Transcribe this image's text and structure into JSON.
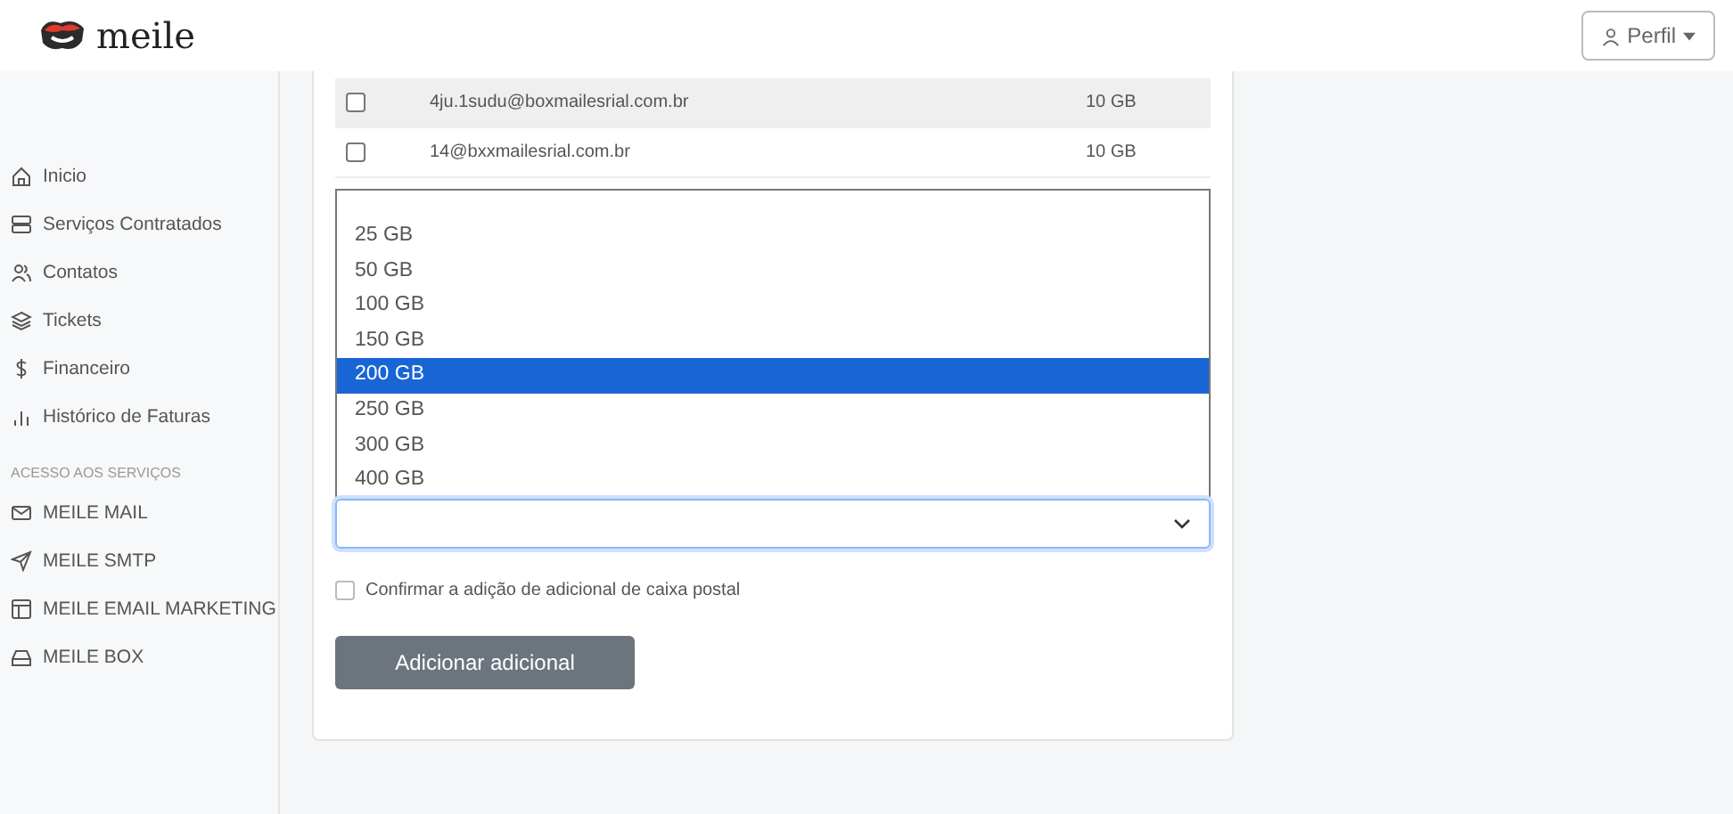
{
  "header": {
    "logo": "meile",
    "profile_button": "Perfil"
  },
  "sidebar": {
    "items": [
      {
        "label": "Inicio"
      },
      {
        "label": "Serviços Contratados"
      },
      {
        "label": "Contatos"
      },
      {
        "label": "Tickets"
      },
      {
        "label": "Financeiro"
      },
      {
        "label": "Histórico de Faturas"
      }
    ],
    "section_title": "ACESSO AOS SERVIÇOS",
    "services": [
      {
        "label": "MEILE MAIL"
      },
      {
        "label": "MEILE SMTP"
      },
      {
        "label": "MEILE EMAIL MARKETING"
      },
      {
        "label": "MEILE BOX"
      }
    ]
  },
  "table": {
    "rows": [
      {
        "checked": false,
        "email": "4ju.1sudu@boxmailesrial.com.br",
        "size": "10 GB"
      },
      {
        "checked": false,
        "email": "14@bxxmailesrial.com.br",
        "size": "10 GB"
      }
    ]
  },
  "dropdown": {
    "options": [
      {
        "label": "25 GB",
        "selected": false
      },
      {
        "label": "50 GB",
        "selected": false
      },
      {
        "label": "100 GB",
        "selected": false
      },
      {
        "label": "150 GB",
        "selected": false
      },
      {
        "label": "200 GB",
        "selected": true
      },
      {
        "label": "250 GB",
        "selected": false
      },
      {
        "label": "300 GB",
        "selected": false
      },
      {
        "label": "400 GB",
        "selected": false
      }
    ]
  },
  "confirm": {
    "label": "Confirmar a adição de adicional de caixa postal",
    "checked": false
  },
  "submit_button": "Adicionar adicional"
}
